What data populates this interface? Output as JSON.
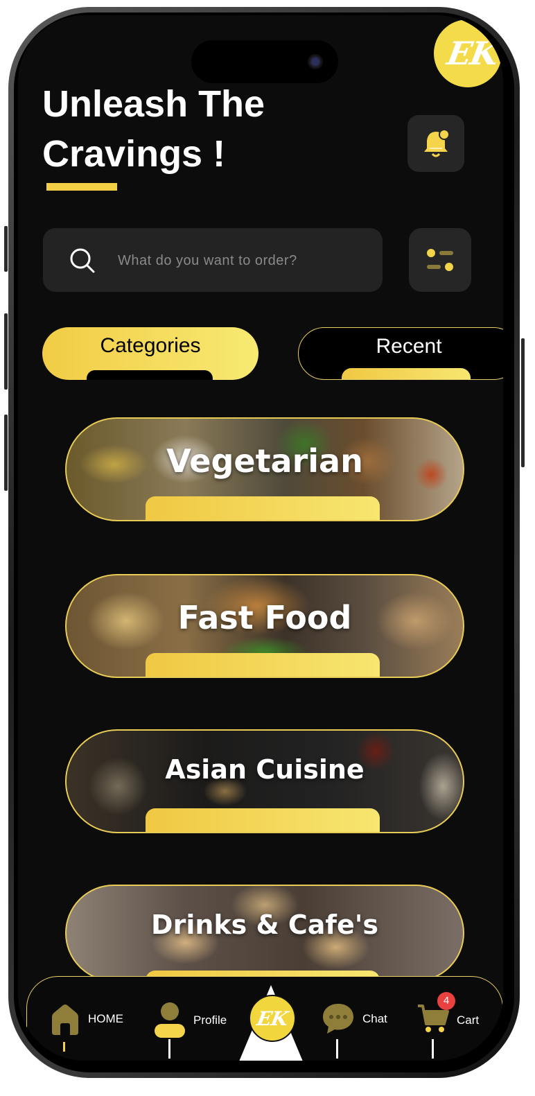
{
  "header": {
    "title_line1": "Unleash The",
    "title_line2": "Cravings !",
    "logo_text": "EK"
  },
  "search": {
    "placeholder": "What do you want to order?"
  },
  "tabs": [
    {
      "label": "Categories",
      "active": true
    },
    {
      "label": "Recent",
      "active": false
    }
  ],
  "categories": [
    {
      "label": "Vegetarian"
    },
    {
      "label": "Fast Food"
    },
    {
      "label": "Asian Cuisine"
    },
    {
      "label": "Drinks & Cafe's"
    }
  ],
  "nav": {
    "home": "HOME",
    "profile": "Profile",
    "center_logo": "EK",
    "chat": "Chat",
    "cart": "Cart",
    "cart_count": "4"
  },
  "colors": {
    "accent": "#f2cf45",
    "background": "#0c0c0c",
    "badge": "#e94040"
  },
  "icons": [
    "bell-icon",
    "search-icon",
    "filter-icon",
    "home-icon",
    "profile-icon",
    "chat-icon",
    "cart-icon"
  ]
}
